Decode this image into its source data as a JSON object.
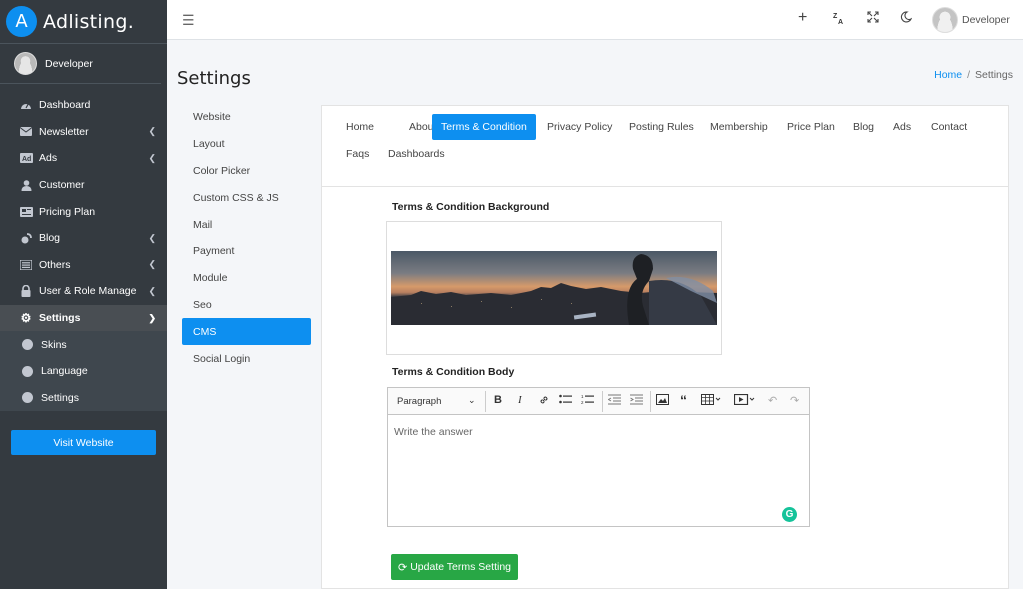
{
  "brand": {
    "logo_letter": "A",
    "name": "Adlisting."
  },
  "user": {
    "name": "Developer"
  },
  "sidebar": {
    "items": [
      {
        "label": "Dashboard",
        "icon": "dashboard-icon"
      },
      {
        "label": "Newsletter",
        "icon": "envelope-icon",
        "has_submenu": true
      },
      {
        "label": "Ads",
        "icon": "ad-icon",
        "has_submenu": true
      },
      {
        "label": "Customer",
        "icon": "user-icon"
      },
      {
        "label": "Pricing Plan",
        "icon": "pricing-icon"
      },
      {
        "label": "Blog",
        "icon": "blog-icon",
        "has_submenu": true
      },
      {
        "label": "Others",
        "icon": "list-icon",
        "has_submenu": true
      },
      {
        "label": "User & Role Manage",
        "icon": "lock-icon",
        "has_submenu": true
      },
      {
        "label": "Settings",
        "icon": "gear-icon",
        "expanded": true
      }
    ],
    "submenu": [
      {
        "label": "Skins"
      },
      {
        "label": "Language"
      },
      {
        "label": "Settings"
      }
    ],
    "visit_button": "Visit Website"
  },
  "topbar": {
    "icons": [
      "plus-icon",
      "translate-icon",
      "fullscreen-icon",
      "moon-icon"
    ],
    "user_name": "Developer"
  },
  "header": {
    "title": "Settings",
    "breadcrumb": {
      "home": "Home",
      "current": "Settings"
    }
  },
  "settings_menu": {
    "items": [
      "Website",
      "Layout",
      "Color Picker",
      "Custom CSS & JS",
      "Mail",
      "Payment",
      "Module",
      "Seo",
      "CMS",
      "Social Login"
    ],
    "active": "CMS"
  },
  "tabs": {
    "items": [
      "Home",
      "About",
      "Terms & Condition",
      "Privacy Policy",
      "Posting Rules",
      "Membership",
      "Price Plan",
      "Blog",
      "Ads",
      "Contact",
      "Faqs",
      "Dashboards"
    ],
    "active": "Terms & Condition"
  },
  "form": {
    "background_label": "Terms & Condition Background",
    "body_label": "Terms & Condition Body",
    "editor": {
      "format_select": "Paragraph",
      "placeholder": "Write the answer",
      "toolbar_icons": [
        "bold-icon",
        "italic-icon",
        "link-icon",
        "bulleted-list-icon",
        "numbered-list-icon",
        "outdent-icon",
        "indent-icon",
        "image-icon",
        "blockquote-icon",
        "table-icon",
        "media-icon",
        "undo-icon",
        "redo-icon"
      ]
    },
    "submit_label": "Update Terms Setting"
  },
  "colors": {
    "primary": "#0d8ff0",
    "success": "#28a745",
    "sidebar_bg": "#343a40"
  }
}
